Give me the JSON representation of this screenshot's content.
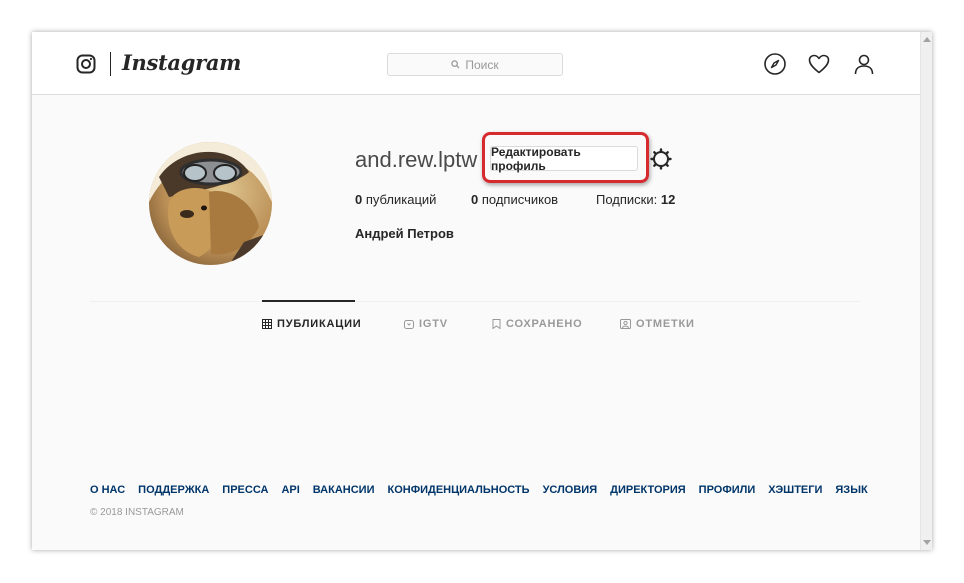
{
  "header": {
    "brand": "Instagram",
    "search_placeholder": "Поиск"
  },
  "profile": {
    "username": "and.rew.lptw",
    "edit_label": "Редактировать профиль",
    "stats": {
      "posts_count": "0",
      "posts_label": "публикаций",
      "followers_count": "0",
      "followers_label": "подписчиков",
      "following_label": "Подписки:",
      "following_count": "12"
    },
    "full_name": "Андрей Петров"
  },
  "tabs": [
    {
      "label": "ПУБЛИКАЦИИ",
      "icon": "grid-icon",
      "active": true
    },
    {
      "label": "IGTV",
      "icon": "igtv-icon",
      "active": false
    },
    {
      "label": "СОХРАНЕНО",
      "icon": "bookmark-icon",
      "active": false
    },
    {
      "label": "ОТМЕТКИ",
      "icon": "tagged-icon",
      "active": false
    }
  ],
  "footer": {
    "links": [
      "О НАС",
      "ПОДДЕРЖКА",
      "ПРЕССА",
      "API",
      "ВАКАНСИИ",
      "КОНФИДЕНЦИАЛЬНОСТЬ",
      "УСЛОВИЯ",
      "ДИРЕКТОРИЯ",
      "ПРОФИЛИ",
      "ХЭШТЕГИ",
      "ЯЗЫК"
    ],
    "copyright": "© 2018 INSTAGRAM"
  },
  "colors": {
    "highlight": "#d62a2f",
    "link": "#003569",
    "text": "#262626",
    "muted": "#999999"
  }
}
